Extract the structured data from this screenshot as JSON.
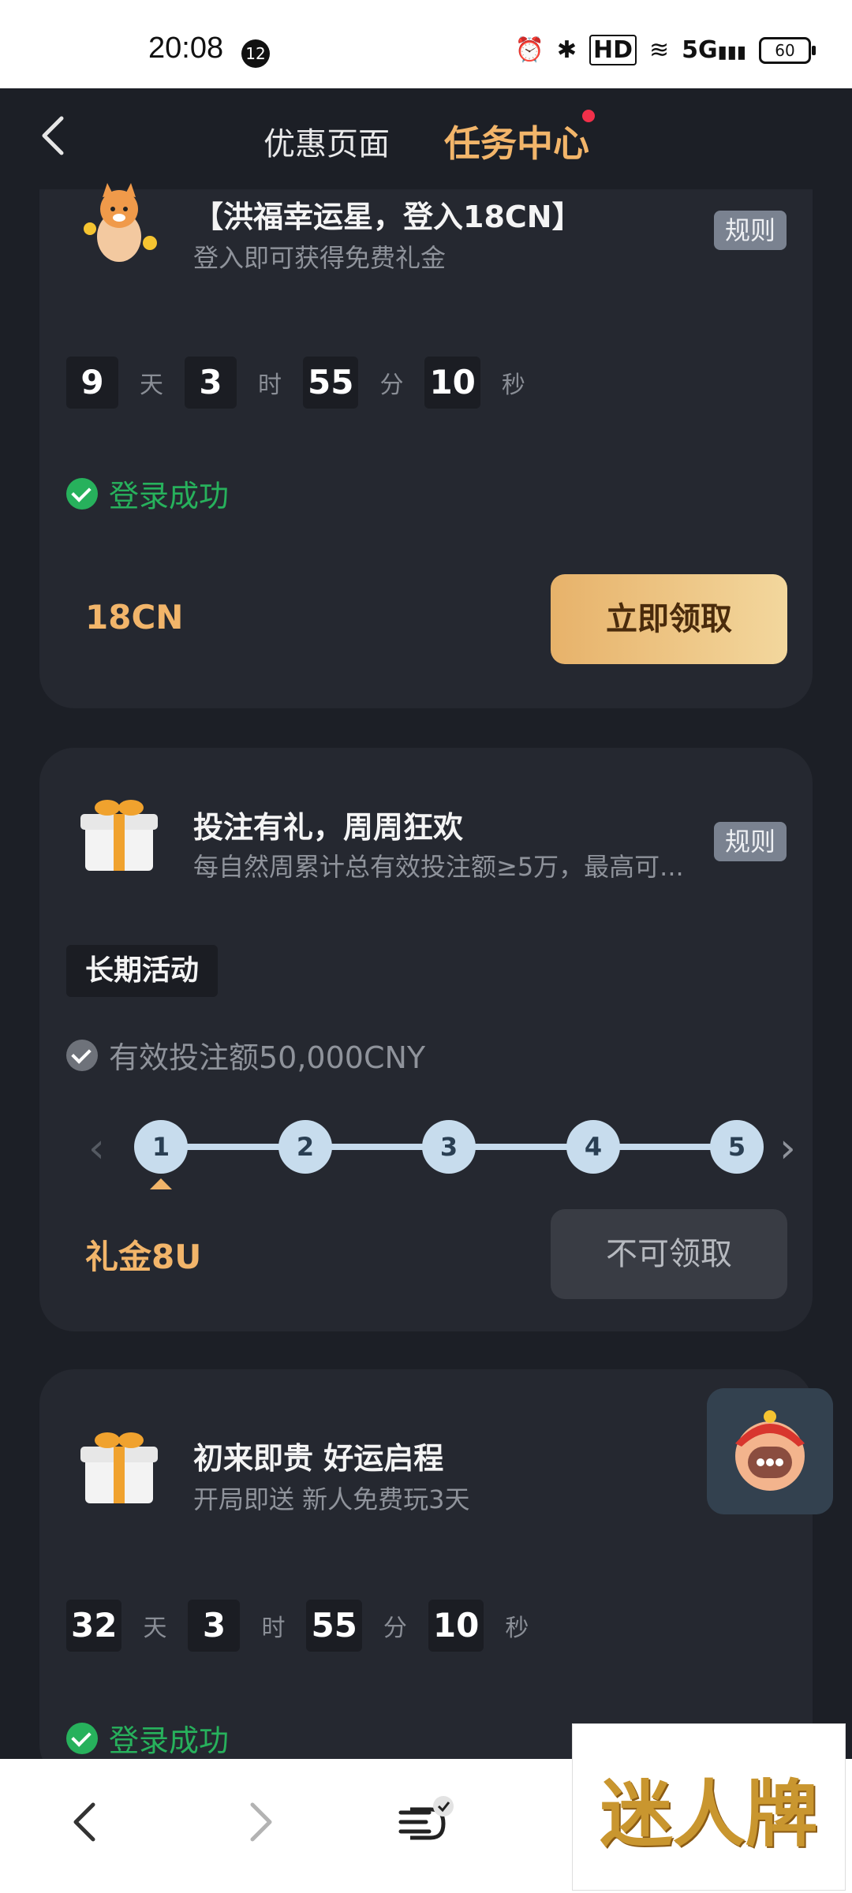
{
  "status_bar": {
    "time": "20:08",
    "notification_count": "12",
    "battery": "60",
    "hd": "HD",
    "net": "5G"
  },
  "header": {
    "tab_promo": "优惠页面",
    "tab_tasks": "任务中心"
  },
  "cards": [
    {
      "title": "【洪福幸运星，登入18CN】",
      "subtitle": "登入即可获得免费礼金",
      "rule": "规则",
      "countdown": {
        "days": "9",
        "day_unit": "天",
        "hours": "3",
        "hour_unit": "时",
        "minutes": "55",
        "minute_unit": "分",
        "seconds": "10",
        "second_unit": "秒"
      },
      "status": "登录成功",
      "reward": "18CN",
      "button": "立即领取"
    },
    {
      "title": "投注有礼，周周狂欢",
      "subtitle": "每自然周累计总有效投注额≥5万，最高可...",
      "rule": "规则",
      "tag": "长期活动",
      "requirement": "有效投注额50,000CNY",
      "steps": [
        "1",
        "2",
        "3",
        "4",
        "5"
      ],
      "reward": "礼金8U",
      "button": "不可领取"
    },
    {
      "title": "初来即贵 好运启程",
      "subtitle": "开局即送 新人免费玩3天",
      "countdown": {
        "days": "32",
        "day_unit": "天",
        "hours": "3",
        "hour_unit": "时",
        "minutes": "55",
        "minute_unit": "分",
        "seconds": "10",
        "second_unit": "秒"
      },
      "status": "登录成功"
    }
  ],
  "watermark": "迷人牌",
  "colors": {
    "accent": "#f2b56a",
    "success": "#27b15c",
    "card_bg": "#252830",
    "page_bg": "#1c1f26"
  }
}
